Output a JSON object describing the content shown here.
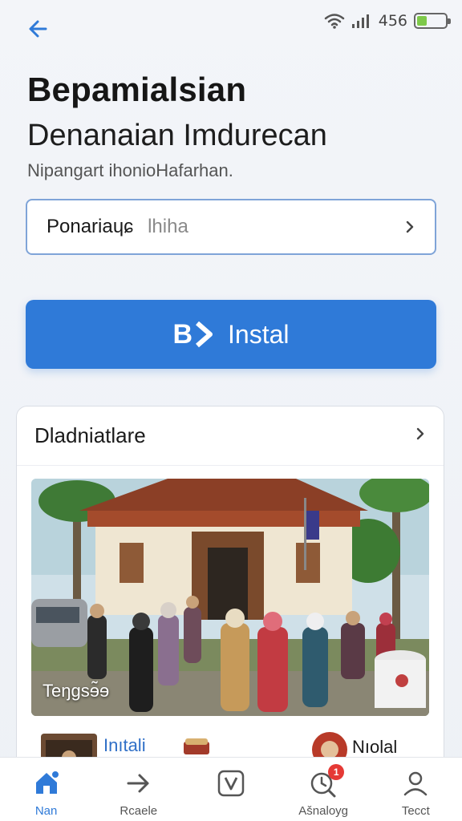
{
  "status_bar": {
    "network_label": "456",
    "battery_level": 0.35
  },
  "header": {
    "title": "Bepamialsian",
    "subtitle": "Denanaian Imdurecan",
    "caption": "Nipangart ihonioHafarhan."
  },
  "selector": {
    "value": "Ponariaɥɕ",
    "hint": "lhiha"
  },
  "install_button": {
    "logo_text": "B",
    "label": "Instal"
  },
  "card": {
    "title": "Dladniatlare",
    "photo_caption": "Teŋgsɘ̃ɘ",
    "row_label_1": "Inıtali",
    "row_label_2": "Nıolal"
  },
  "bottom_nav": {
    "items": [
      {
        "label": "Nan",
        "icon": "home-icon",
        "active": true
      },
      {
        "label": "Rcaele",
        "icon": "arrow-right-icon",
        "active": false
      },
      {
        "label": "",
        "icon": "v-box-icon",
        "active": false
      },
      {
        "label": "Ašnaloyg",
        "icon": "clock-search-icon",
        "active": false,
        "badge": "1"
      },
      {
        "label": "Tecct",
        "icon": "profile-icon",
        "active": false
      }
    ]
  },
  "colors": {
    "accent": "#2f7ad8",
    "background": "#f3f5f9",
    "badge": "#e53935",
    "battery": "#7ec94a"
  }
}
